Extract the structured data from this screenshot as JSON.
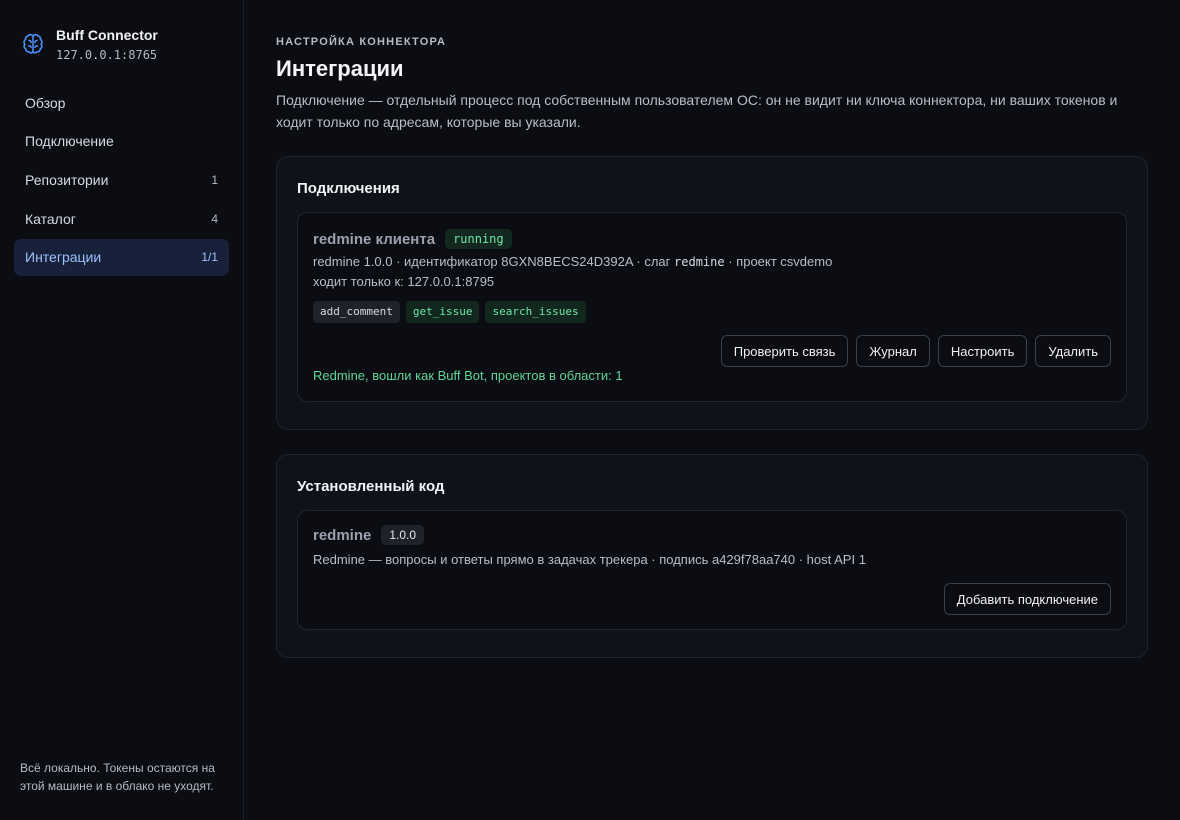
{
  "app": {
    "title": "Buff Connector",
    "address": "127.0.0.1:8765"
  },
  "nav": [
    {
      "label": "Обзор",
      "count": ""
    },
    {
      "label": "Подключение",
      "count": ""
    },
    {
      "label": "Репозитории",
      "count": "1"
    },
    {
      "label": "Каталог",
      "count": "4"
    },
    {
      "label": "Интеграции",
      "count": "1/1",
      "active": true
    }
  ],
  "sidebar_note": "Всё локально. Токены остаются на этой машине и в облако не уходят.",
  "header": {
    "eyebrow": "НАСТРОЙКА КОННЕКТОРА",
    "title": "Интеграции",
    "description": "Подключение — отдельный процесс под собственным пользователем ОС: он не видит ни ключа коннектора, ни ваших токенов и ходит только по адресам, которые вы указали."
  },
  "connections": {
    "title": "Подключения",
    "item": {
      "name": "redmine клиента",
      "status": "running",
      "meta_prefix": "redmine 1.0.0 · идентификатор 8GXN8BECS24D392A · слаг",
      "slug": "redmine",
      "meta_suffix": "· проект csvdemo",
      "allowed": "ходит только к: 127.0.0.1:8795",
      "tools": [
        "add_comment",
        "get_issue",
        "search_issues"
      ],
      "buttons": {
        "check": "Проверить связь",
        "log": "Журнал",
        "configure": "Настроить",
        "delete": "Удалить"
      },
      "status_text": "Redmine, вошли как Buff Bot, проектов в области: 1"
    }
  },
  "installed": {
    "title": "Установленный код",
    "item": {
      "name": "redmine",
      "version": "1.0.0",
      "description": "Redmine — вопросы и ответы прямо в задачах трекера · подпись a429f78aa740 · host API 1",
      "add_button": "Добавить подключение"
    }
  },
  "colors": {
    "background": "#0b0d12",
    "accent": "#9ec0ff",
    "active_nav_bg": "#17213a",
    "success": "#6ee7a8"
  },
  "icons": {
    "brand": "brain-icon"
  }
}
